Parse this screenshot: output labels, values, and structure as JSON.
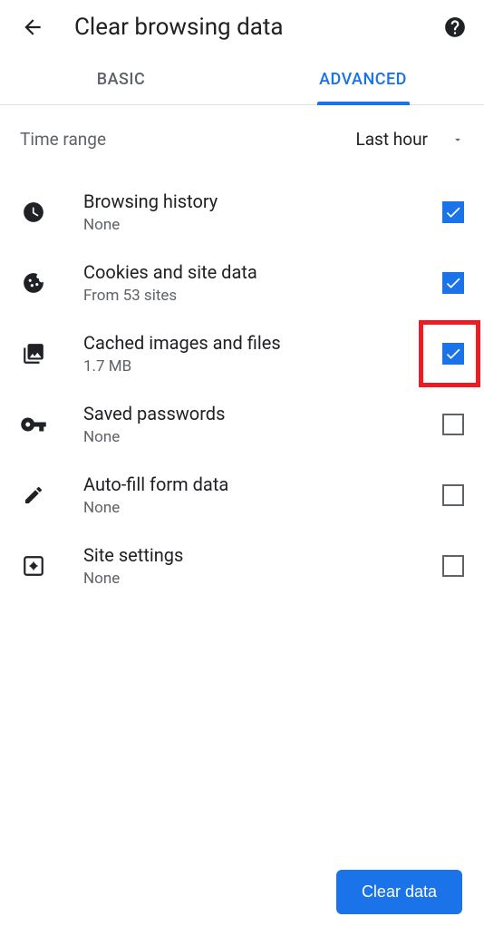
{
  "header": {
    "title": "Clear browsing data"
  },
  "tabs": {
    "basic": "BASIC",
    "advanced": "ADVANCED"
  },
  "time_range": {
    "label": "Time range",
    "value": "Last hour"
  },
  "options": {
    "browsing_history": {
      "title": "Browsing history",
      "subtitle": "None",
      "checked": true
    },
    "cookies": {
      "title": "Cookies and site data",
      "subtitle": "From 53 sites",
      "checked": true
    },
    "cached": {
      "title": "Cached images and files",
      "subtitle": "1.7 MB",
      "checked": true
    },
    "passwords": {
      "title": "Saved passwords",
      "subtitle": "None",
      "checked": false
    },
    "autofill": {
      "title": "Auto-fill form data",
      "subtitle": "None",
      "checked": false
    },
    "site_settings": {
      "title": "Site settings",
      "subtitle": "None",
      "checked": false
    }
  },
  "clear_button": "Clear data",
  "highlighted_option": "cached"
}
